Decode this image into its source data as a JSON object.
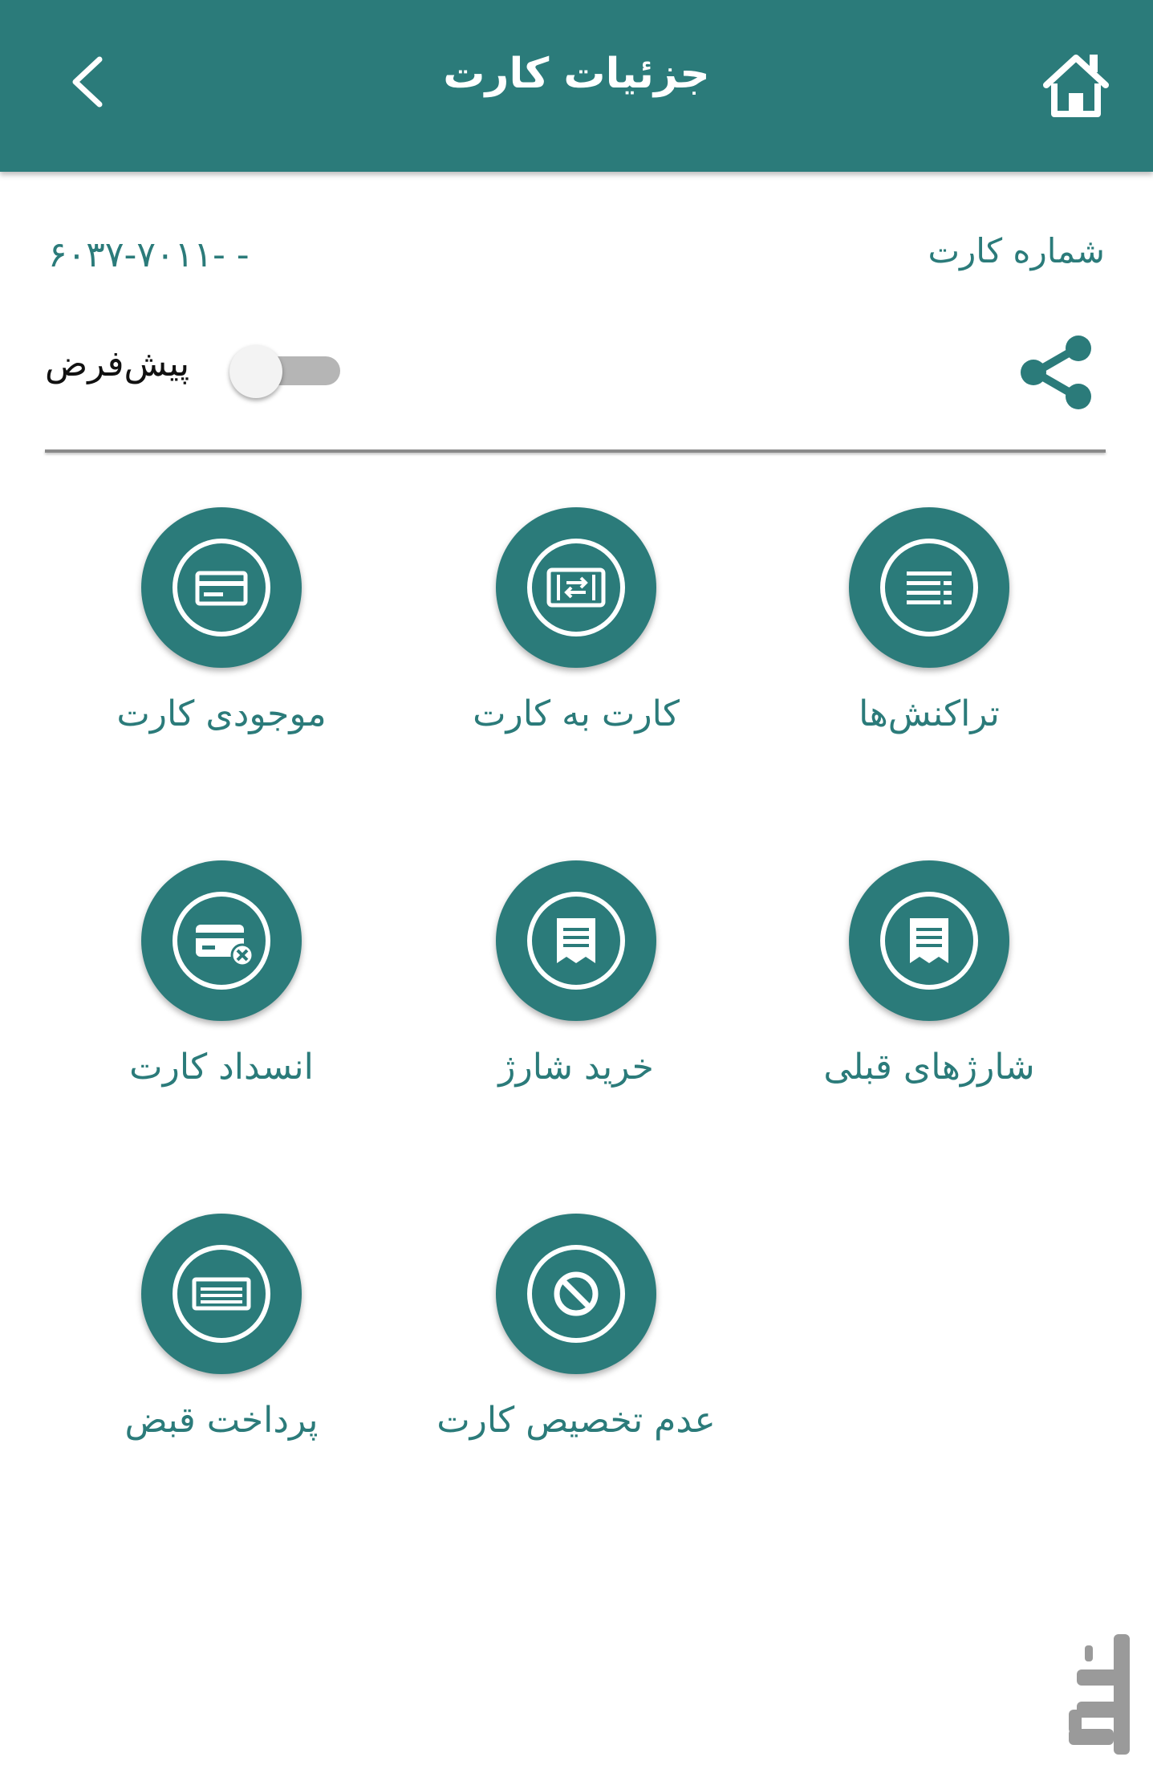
{
  "header": {
    "title": "جزئیات کارت",
    "back_icon": "chevron-left-icon",
    "home_icon": "home-icon"
  },
  "card": {
    "label": "شماره کارت",
    "number": "۶۰۳۷-۷۰۱۱-         -"
  },
  "default_toggle": {
    "label": "پیش‌فرض",
    "checked": false
  },
  "actions": [
    {
      "id": "transactions",
      "label": "تراکنش‌ها",
      "icon": "list-icon"
    },
    {
      "id": "card-to-card",
      "label": "کارت به کارت",
      "icon": "transfer-icon"
    },
    {
      "id": "card-balance",
      "label": "موجودی کارت",
      "icon": "credit-card-icon"
    },
    {
      "id": "previous-charges",
      "label": "شارژهای قبلی",
      "icon": "receipt-icon"
    },
    {
      "id": "buy-charge",
      "label": "خرید شارژ",
      "icon": "receipt-icon"
    },
    {
      "id": "block-card",
      "label": "انسداد کارت",
      "icon": "card-blocked-icon"
    },
    {
      "id": "card-unassign",
      "label": "عدم تخصیص کارت",
      "icon": "prohibited-icon"
    },
    {
      "id": "bill-payment",
      "label": "پرداخت قبض",
      "icon": "bill-icon"
    }
  ],
  "colors": {
    "primary": "#2b7b7a",
    "toggle_track": "#b5b5b5",
    "divider": "#8a8a8a"
  }
}
